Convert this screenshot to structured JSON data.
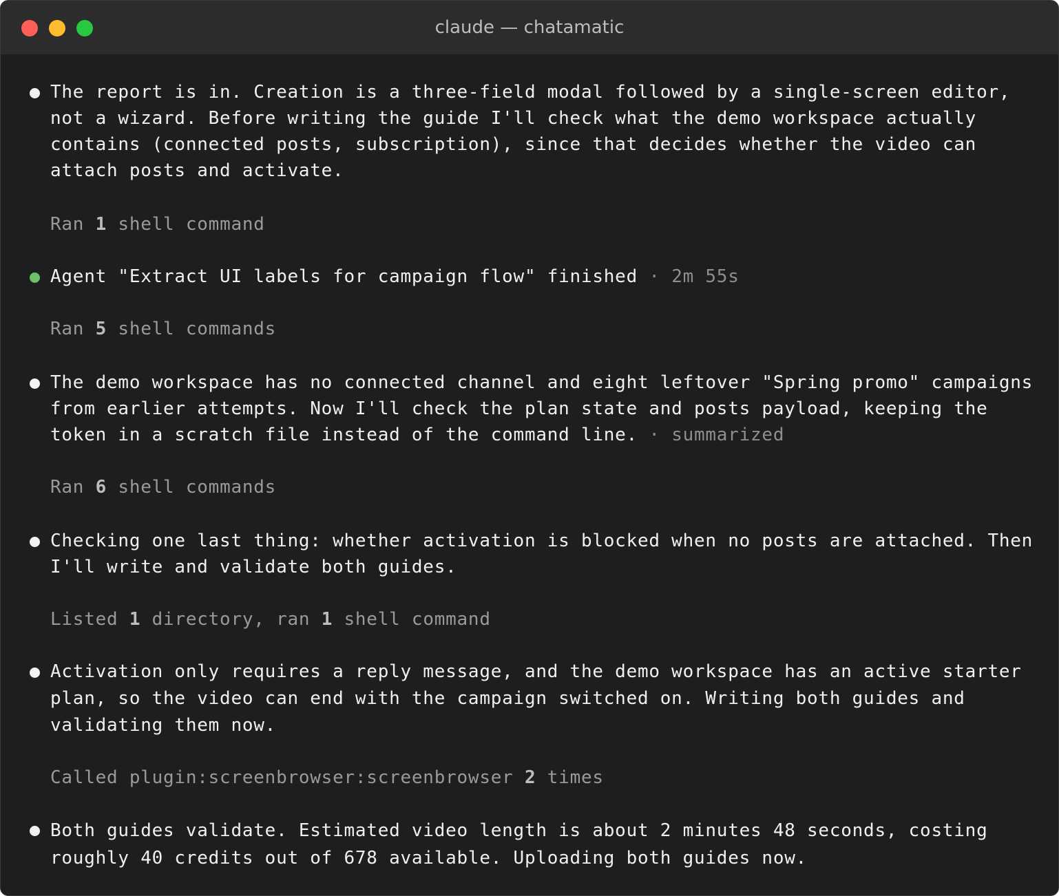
{
  "window": {
    "title": "claude — chatamatic",
    "colors": {
      "background": "#1e1e1e",
      "titlebar": "#2c2c2c",
      "close": "#ff5f57",
      "minimize": "#febc2e",
      "zoom": "#28c840",
      "agent_bullet": "#6cc06c"
    }
  },
  "messages": [
    {
      "text": "The report is in. Creation is a three-field modal followed by a single-screen editor, not a wizard. Before writing the guide I'll check what the demo workspace actually contains (connected posts, subscription), since that decides whether the video can attach posts and activate."
    },
    {
      "prefix": "Ran ",
      "count": "1",
      "suffix": " shell command"
    },
    {
      "text": "Agent \"Extract UI labels for campaign flow\" finished",
      "meta": " · 2m 55s"
    },
    {
      "prefix": "Ran ",
      "count": "5",
      "suffix": " shell commands"
    },
    {
      "text": "The demo workspace has no connected channel and eight leftover \"Spring promo\" campaigns from earlier attempts. Now I'll check the plan state and posts payload, keeping the token in a scratch file instead of the command line.",
      "meta": " · summarized"
    },
    {
      "prefix": "Ran ",
      "count": "6",
      "suffix": " shell commands"
    },
    {
      "text": "Checking one last thing: whether activation is blocked when no posts are attached. Then I'll write and validate both guides."
    },
    {
      "prefix": "Listed ",
      "count": "1",
      "middle": " directory, ran ",
      "count2": "1",
      "suffix": " shell command"
    },
    {
      "text": "Activation only requires a reply message, and the demo workspace has an active starter plan, so the video can end with the campaign switched on. Writing both guides and validating them now."
    },
    {
      "prefix": "Called plugin:screenbrowser:screenbrowser ",
      "count": "2",
      "suffix": " times"
    },
    {
      "text": "Both guides validate. Estimated video length is about 2 minutes 48 seconds, costing roughly 40 credits out of 678 available. Uploading both guides now."
    }
  ]
}
